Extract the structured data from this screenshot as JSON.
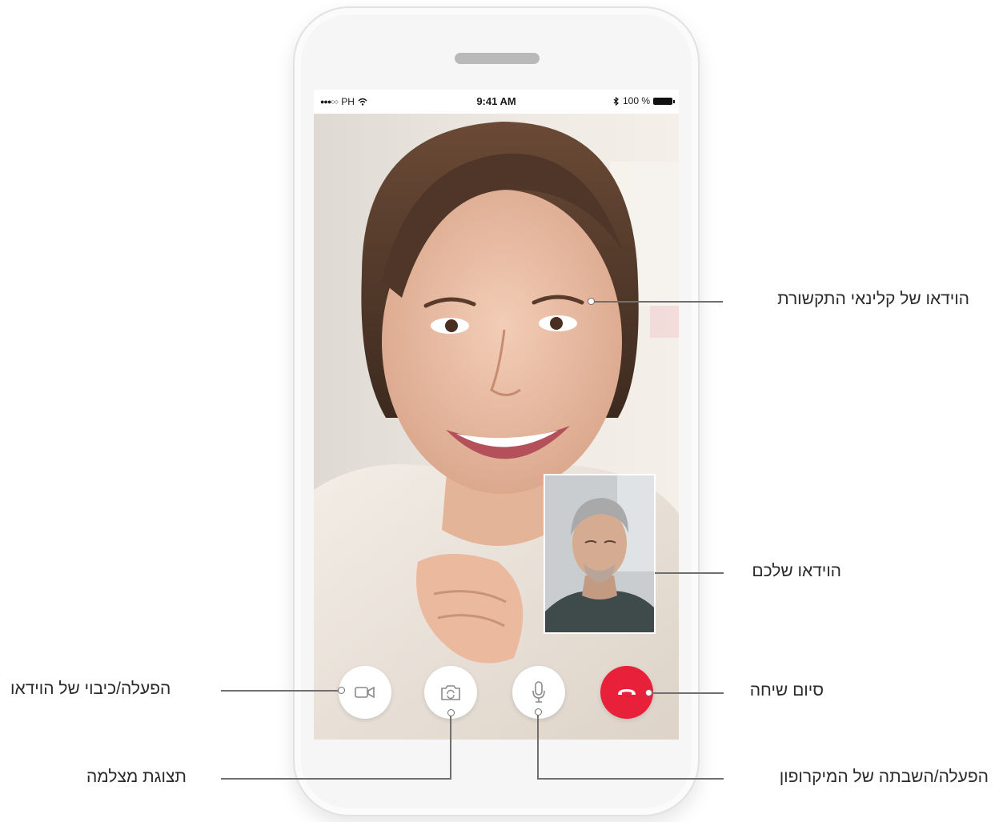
{
  "status_bar": {
    "carrier": "PH",
    "time": "9:41 AM",
    "battery": "100 %"
  },
  "controls": {
    "video_toggle_icon": "video-camera-icon",
    "switch_camera_icon": "camera-switch-icon",
    "microphone_icon": "microphone-icon",
    "end_call_icon": "hang-up-icon",
    "end_call_color": "#e8203a"
  },
  "callouts": {
    "clinician_video": "הוידאו של קלינאי התקשורת",
    "your_video": "הוידאו שלכם",
    "end_call": "סיום שיחה",
    "microphone_toggle": "הפעלה/השבתה של המיקרופון",
    "video_toggle": "הפעלה/כיבוי של הוידאו",
    "camera_view": "תצוגת מצלמה"
  }
}
